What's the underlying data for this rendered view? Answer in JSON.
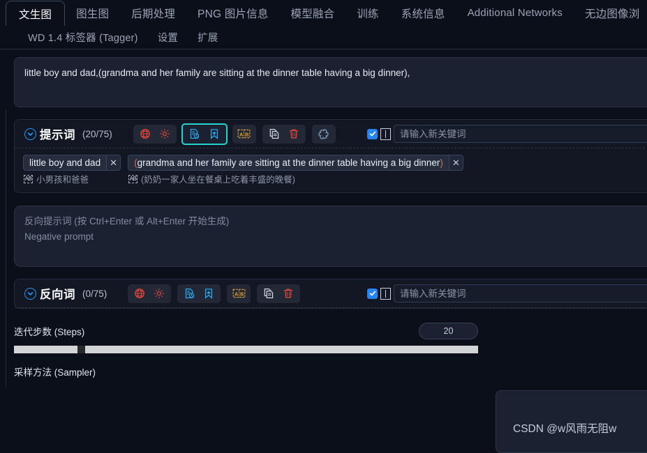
{
  "tabs": {
    "row1": [
      {
        "label": "文生图",
        "active": true
      },
      {
        "label": "图生图",
        "active": false
      },
      {
        "label": "后期处理",
        "active": false
      },
      {
        "label": "PNG 图片信息",
        "active": false
      },
      {
        "label": "模型融合",
        "active": false
      },
      {
        "label": "训练",
        "active": false
      },
      {
        "label": "系统信息",
        "active": false
      },
      {
        "label": "Additional Networks",
        "active": false
      },
      {
        "label": "无边图像浏",
        "active": false
      }
    ],
    "row2": [
      {
        "label": "WD 1.4 标签器 (Tagger)"
      },
      {
        "label": "设置"
      },
      {
        "label": "扩展"
      }
    ]
  },
  "prompt": {
    "value": "little boy and dad,(grandma and her family are sitting at the dinner table having a big dinner),"
  },
  "positive_section": {
    "title": "提示词",
    "count": "(20/75)",
    "keyword_placeholder": "请输入新关键词",
    "keyword_value": "",
    "buttons": [
      {
        "name": "globe-icon",
        "color": "#e0463c"
      },
      {
        "name": "gear-icon",
        "color": "#e0463c"
      },
      {
        "name": "document-clock-icon",
        "color": "#2aa9f0"
      },
      {
        "name": "bookmark-star-icon",
        "color": "#2aa9f0"
      },
      {
        "name": "translate-ab-icon",
        "color": "#e8a32a"
      },
      {
        "name": "copy-icon",
        "color": "#d5dbe6"
      },
      {
        "name": "trash-icon",
        "color": "#e0463c"
      },
      {
        "name": "chatgpt-icon",
        "color": "#7fa4c4"
      }
    ],
    "chips": [
      {
        "text": "little boy and dad",
        "translation": "小男孩和爸爸",
        "remove": "✕"
      },
      {
        "text": "(grandma and her family are sitting at the dinner table having a big dinner)",
        "open_paren": "(",
        "body": "grandma and her family are sitting at the dinner table having a big dinner",
        "close_paren": ")",
        "translation": "(奶奶一家人坐在餐桌上吃着丰盛的晚餐)",
        "remove": "✕"
      }
    ]
  },
  "negative_prompt": {
    "line1": "反向提示词 (按 Ctrl+Enter 或 Alt+Enter 开始生成)",
    "line2": "Negative prompt"
  },
  "negative_section": {
    "title": "反向词",
    "count": "(0/75)",
    "keyword_placeholder": "请输入新关键词",
    "keyword_value": ""
  },
  "params": {
    "steps_label": "迭代步数 (Steps)",
    "steps_value": "20",
    "sampler_label": "采样方法 (Sampler)"
  },
  "watermark": {
    "text": "CSDN @w风雨无阻w"
  },
  "colors": {
    "background": "#0b0f19",
    "panel": "#121723",
    "accent_blue": "#2196f3",
    "highlight_teal": "#22d3cf",
    "red": "#e0463c",
    "orange": "#e8a32a"
  }
}
